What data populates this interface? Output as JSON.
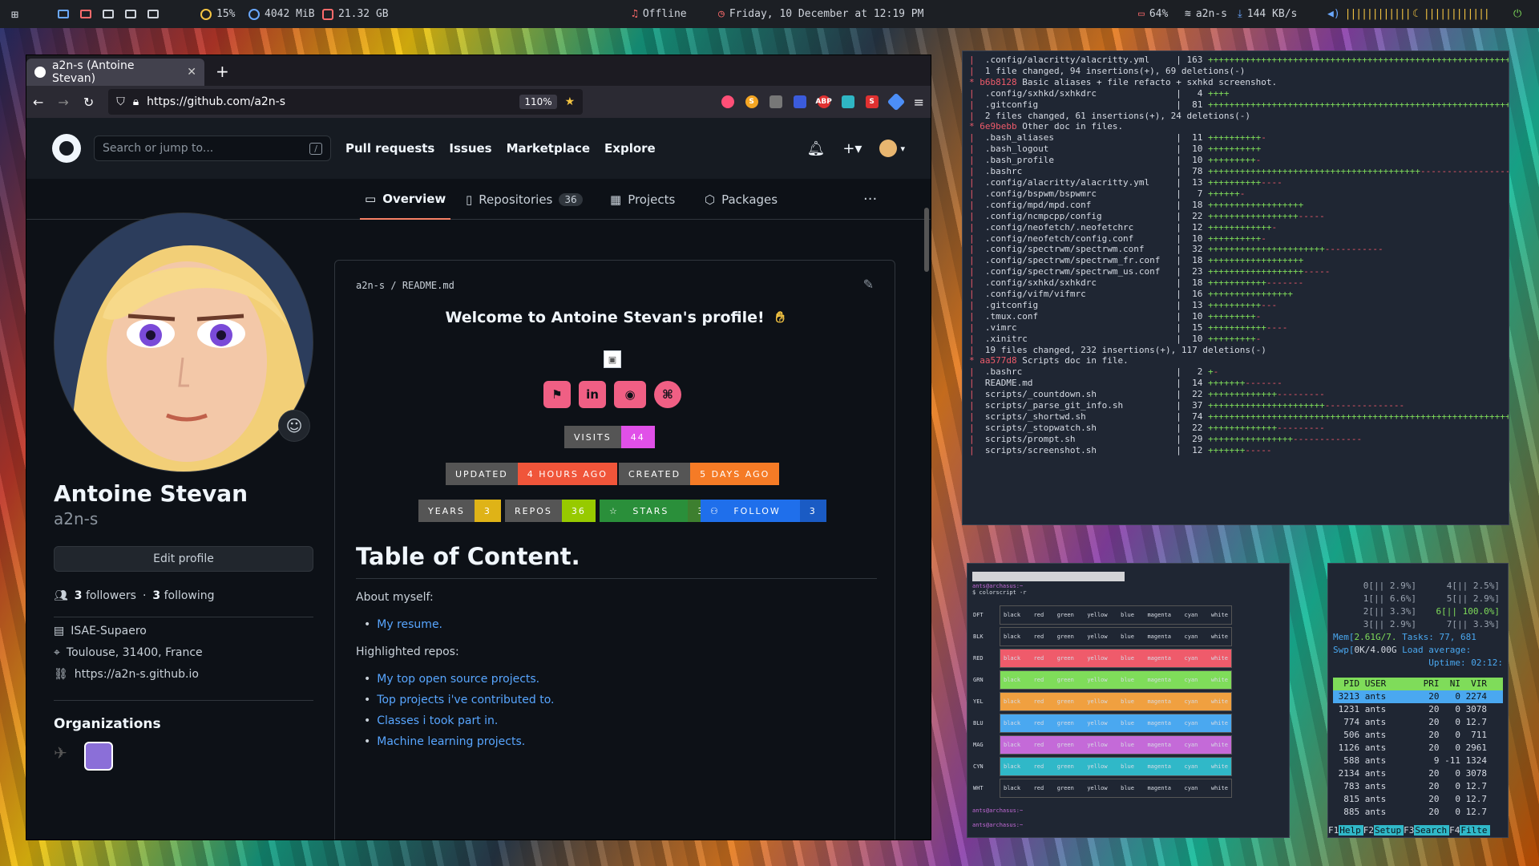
{
  "topbar": {
    "cpu": "15%",
    "mem": "4042 MiB",
    "disk": "21.32 GB",
    "music": "Offline",
    "datetime": "Friday, 10 December at 12:19 PM",
    "battery": "64%",
    "wifi": "a2n-s",
    "net": "144 KB/s"
  },
  "browser": {
    "tab_title": "a2n-s (Antoine Stevan)",
    "url": "https://github.com/a2n-s",
    "zoom": "110%"
  },
  "github": {
    "search_placeholder": "Search or jump to...",
    "search_key": "/",
    "nav": [
      "Pull requests",
      "Issues",
      "Marketplace",
      "Explore"
    ],
    "tabs": {
      "overview": "Overview",
      "repositories": "Repositories",
      "repo_count": "36",
      "projects": "Projects",
      "packages": "Packages"
    },
    "profile": {
      "name": "Antoine Stevan",
      "login": "a2n-s",
      "edit": "Edit profile",
      "followers_count": "3",
      "followers_label": "followers",
      "following_count": "3",
      "following_label": "following",
      "org": "ISAE-Supaero",
      "location": "Toulouse, 31400, France",
      "website": "https://a2n-s.github.io",
      "orgs_title": "Organizations"
    },
    "readme": {
      "owner": "a2n-s",
      "file": "README.md",
      "welcome": "Welcome to Antoine Stevan's profile!",
      "badges": {
        "visits_label": "VISITS",
        "visits_value": "44",
        "updated_label": "UPDATED",
        "updated_value": "4 HOURS AGO",
        "created_label": "CREATED",
        "created_value": "5 DAYS AGO",
        "years_label": "YEARS",
        "years_value": "3",
        "repos_label": "REPOS",
        "repos_value": "36",
        "stars_label": "STARS",
        "stars_value": "3",
        "follow_label": "FOLLOW",
        "follow_value": "3"
      },
      "toc_title": "Table of Content.",
      "about": "About myself:",
      "resume": "My resume.",
      "highlighted": "Highlighted repos:",
      "links": [
        "My top open source projects.",
        "Top projects i've contributed to.",
        "Classes i took part in.",
        "Machine learning projects."
      ]
    }
  },
  "git_log": [
    {
      "type": "file",
      "name": ".config/alacritty/alacritty.yml",
      "n": "163",
      "plus": "++++++++++++++++++++++++++++++++++++++++++++++++++++++++++++",
      "minus": "---------"
    },
    {
      "type": "text",
      "text": "  1 file changed, 94 insertions(+), 69 deletions(-)"
    },
    {
      "type": "commit",
      "hash": "b6b8128",
      "msg": "Basic aliases + file refacto + sxhkd screenshot."
    },
    {
      "type": "file",
      "name": ".config/sxhkd/sxhkdrc",
      "n": "4",
      "plus": "++++",
      "minus": ""
    },
    {
      "type": "file",
      "name": ".gitconfig",
      "n": "81",
      "plus": "++++++++++++++++++++++++++++++++++++++++++++++++++++++++++++",
      "minus": "----------"
    },
    {
      "type": "text",
      "text": "  2 files changed, 61 insertions(+), 24 deletions(-)"
    },
    {
      "type": "commit",
      "hash": "6e9bebb",
      "msg": "Other doc in files."
    },
    {
      "type": "file",
      "name": ".bash_aliases",
      "n": "11",
      "plus": "++++++++++",
      "minus": "-"
    },
    {
      "type": "file",
      "name": ".bash_logout",
      "n": "10",
      "plus": "++++++++++",
      "minus": ""
    },
    {
      "type": "file",
      "name": ".bash_profile",
      "n": "10",
      "plus": "+++++++++",
      "minus": "-"
    },
    {
      "type": "file",
      "name": ".bashrc",
      "n": "78",
      "plus": "++++++++++++++++++++++++++++++++++++++++",
      "minus": "-----------------------------------"
    },
    {
      "type": "file",
      "name": ".config/alacritty/alacritty.yml",
      "n": "13",
      "plus": "++++++++++",
      "minus": "----"
    },
    {
      "type": "file",
      "name": ".config/bspwm/bspwmrc",
      "n": "7",
      "plus": "++++++",
      "minus": "-"
    },
    {
      "type": "file",
      "name": ".config/mpd/mpd.conf",
      "n": "18",
      "plus": "++++++++++++++++++",
      "minus": ""
    },
    {
      "type": "file",
      "name": ".config/ncmpcpp/config",
      "n": "22",
      "plus": "+++++++++++++++++",
      "minus": "-----"
    },
    {
      "type": "file",
      "name": ".config/neofetch/.neofetchrc",
      "n": "12",
      "plus": "++++++++++++",
      "minus": "-"
    },
    {
      "type": "file",
      "name": ".config/neofetch/config.conf",
      "n": "10",
      "plus": "++++++++++",
      "minus": "-"
    },
    {
      "type": "file",
      "name": ".config/spectrwm/spectrwm.conf",
      "n": "32",
      "plus": "++++++++++++++++++++++",
      "minus": "-----------"
    },
    {
      "type": "file",
      "name": ".config/spectrwm/spectrwm_fr.conf",
      "n": "18",
      "plus": "++++++++++++++++++",
      "minus": ""
    },
    {
      "type": "file",
      "name": ".config/spectrwm/spectrwm_us.conf",
      "n": "23",
      "plus": "++++++++++++++++++",
      "minus": "-----"
    },
    {
      "type": "file",
      "name": ".config/sxhkd/sxhkdrc",
      "n": "18",
      "plus": "+++++++++++",
      "minus": "-------"
    },
    {
      "type": "file",
      "name": ".config/vifm/vifmrc",
      "n": "16",
      "plus": "++++++++++++++++",
      "minus": ""
    },
    {
      "type": "file",
      "name": ".gitconfig",
      "n": "13",
      "plus": "++++++++++",
      "minus": "---"
    },
    {
      "type": "file",
      "name": ".tmux.conf",
      "n": "10",
      "plus": "+++++++++",
      "minus": "-"
    },
    {
      "type": "file",
      "name": ".vimrc",
      "n": "15",
      "plus": "+++++++++++",
      "minus": "----"
    },
    {
      "type": "file",
      "name": ".xinitrc",
      "n": "10",
      "plus": "+++++++++",
      "minus": "-"
    },
    {
      "type": "text",
      "text": "  19 files changed, 232 insertions(+), 117 deletions(-)"
    },
    {
      "type": "commit",
      "hash": "aa577d8",
      "msg": "Scripts doc in file."
    },
    {
      "type": "file",
      "name": ".bashrc",
      "n": "2",
      "plus": "+",
      "minus": "-"
    },
    {
      "type": "file",
      "name": "README.md",
      "n": "14",
      "plus": "+++++++",
      "minus": "-------"
    },
    {
      "type": "file",
      "name": "scripts/_countdown.sh",
      "n": "22",
      "plus": "+++++++++++++",
      "minus": "---------"
    },
    {
      "type": "file",
      "name": "scripts/_parse_git_info.sh",
      "n": "37",
      "plus": "++++++++++++++++++++++",
      "minus": "---------------"
    },
    {
      "type": "file",
      "name": "scripts/_shortwd.sh",
      "n": "74",
      "plus": "++++++++++++++++++++++++++++++++++++++++++++++++++++++++++++",
      "minus": ""
    },
    {
      "type": "file",
      "name": "scripts/_stopwatch.sh",
      "n": "22",
      "plus": "+++++++++++++",
      "minus": "---------"
    },
    {
      "type": "file",
      "name": "scripts/prompt.sh",
      "n": "29",
      "plus": "++++++++++++++++",
      "minus": "-------------"
    },
    {
      "type": "file",
      "name": "scripts/screenshot.sh",
      "n": "12",
      "plus": "+++++++",
      "minus": "-----"
    }
  ],
  "colorscript": {
    "prompt1": "ants@archasus:~",
    "cmd": "$ colorscript -r",
    "rows": [
      "DFT",
      "BLK",
      "RED",
      "GRN",
      "YEL",
      "BLU",
      "MAG",
      "CYN",
      "WHT"
    ],
    "cols": [
      "black",
      "red",
      "green",
      "yellow",
      "blue",
      "magenta",
      "cyan",
      "white"
    ],
    "rowcolors": [
      "#1f2633",
      "#1f2633",
      "#ef5b6b",
      "#7fdc5a",
      "#f0a040",
      "#4aa8f0",
      "#c46ad8",
      "#30b8c8",
      "#1f2633"
    ],
    "prompt2": "ants@archasus:~",
    "prompt3": "ants@archasus:~"
  },
  "htop": {
    "cpus": [
      {
        "id": "0",
        "val": "2.9%"
      },
      {
        "id": "4",
        "val": "2.5%"
      },
      {
        "id": "1",
        "val": "6.6%"
      },
      {
        "id": "5",
        "val": "2.9%"
      },
      {
        "id": "2",
        "val": "3.3%"
      },
      {
        "id": "6",
        "val": "100.0%"
      },
      {
        "id": "3",
        "val": "2.9%"
      },
      {
        "id": "7",
        "val": "3.3%"
      }
    ],
    "mem": "2.61G/7.",
    "swp": "0K/4.00G",
    "tasks": "Tasks: 77, 681",
    "load": "Load average:",
    "uptime": "Uptime: 02:12:",
    "header": [
      "PID",
      "USER",
      "PRI",
      "NI",
      "VIR"
    ],
    "procs": [
      [
        "3213",
        "ants",
        "20",
        "0",
        "2274"
      ],
      [
        "1231",
        "ants",
        "20",
        "0",
        "3078"
      ],
      [
        "774",
        "ants",
        "20",
        "0",
        "12.7"
      ],
      [
        "506",
        "ants",
        "20",
        "0",
        "711"
      ],
      [
        "1126",
        "ants",
        "20",
        "0",
        "2961"
      ],
      [
        "588",
        "ants",
        "9",
        "-11",
        "1324"
      ],
      [
        "2134",
        "ants",
        "20",
        "0",
        "3078"
      ],
      [
        "783",
        "ants",
        "20",
        "0",
        "12.7"
      ],
      [
        "815",
        "ants",
        "20",
        "0",
        "12.7"
      ],
      [
        "885",
        "ants",
        "20",
        "0",
        "12.7"
      ]
    ],
    "fkeys": [
      [
        "F1",
        "Help"
      ],
      [
        "F2",
        "Setup"
      ],
      [
        "F3",
        "Search"
      ],
      [
        "F4",
        "Filte"
      ]
    ]
  }
}
